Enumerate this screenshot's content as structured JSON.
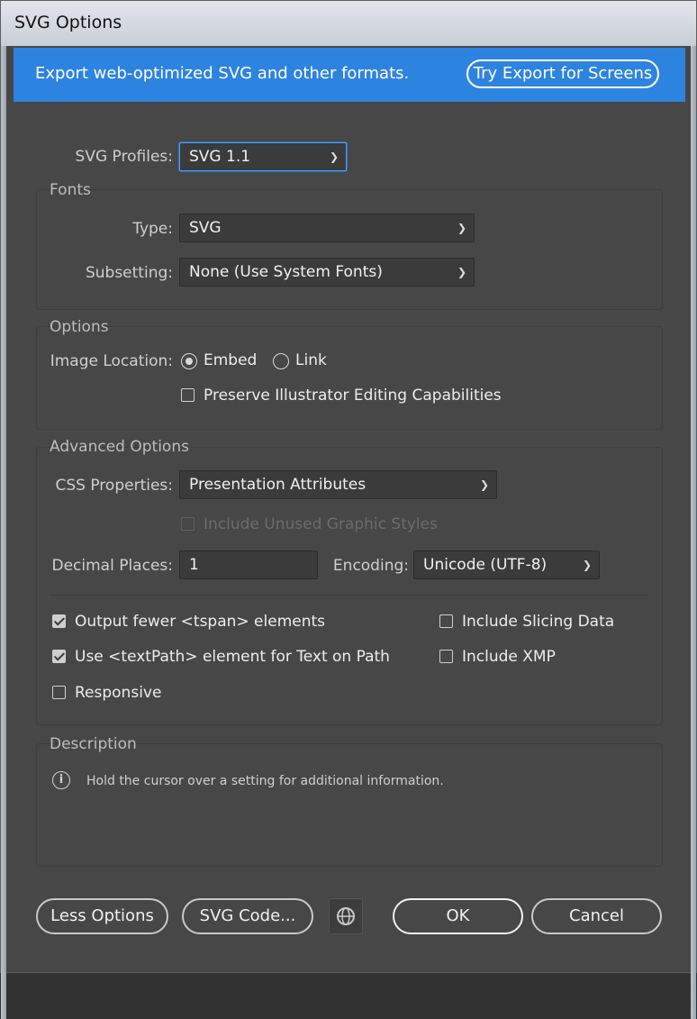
{
  "window": {
    "title": "SVG Options"
  },
  "banner": {
    "text": "Export web-optimized SVG and other formats.",
    "button": "Try Export for Screens"
  },
  "profile": {
    "label": "SVG Profiles:",
    "value": "SVG 1.1"
  },
  "fonts": {
    "title": "Fonts",
    "type_label": "Type:",
    "type_value": "SVG",
    "subsetting_label": "Subsetting:",
    "subsetting_value": "None (Use System Fonts)"
  },
  "options": {
    "title": "Options",
    "image_location_label": "Image Location:",
    "embed_label": "Embed",
    "link_label": "Link",
    "preserve_label": "Preserve Illustrator Editing Capabilities"
  },
  "advanced": {
    "title": "Advanced Options",
    "css_label": "CSS Properties:",
    "css_value": "Presentation Attributes",
    "unused_styles_label": "Include Unused Graphic Styles",
    "decimal_label": "Decimal Places:",
    "decimal_value": "1",
    "encoding_label": "Encoding:",
    "encoding_value": "Unicode (UTF-8)",
    "tspan_label": "Output fewer <tspan> elements",
    "textpath_label": "Use <textPath> element for Text on Path",
    "responsive_label": "Responsive",
    "slicing_label": "Include Slicing Data",
    "xmp_label": "Include XMP"
  },
  "description": {
    "title": "Description",
    "text": "Hold the cursor over a setting for additional information."
  },
  "buttons": {
    "less": "Less Options",
    "code": "SVG Code...",
    "ok": "OK",
    "cancel": "Cancel"
  },
  "colors": {
    "accent": "#2d83e0",
    "panel": "#474747"
  }
}
